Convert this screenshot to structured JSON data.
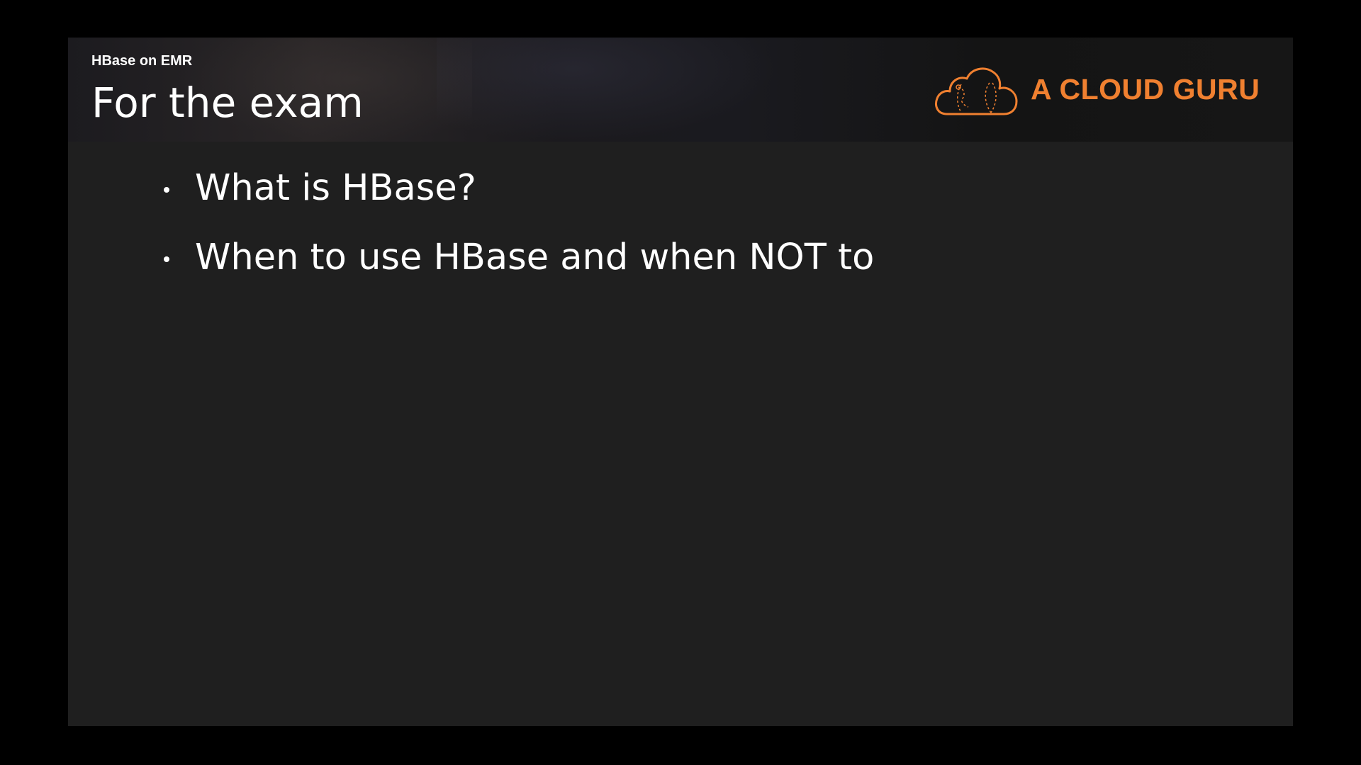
{
  "header": {
    "subtitle": "HBase on EMR",
    "title": "For the exam"
  },
  "logo": {
    "text": "A CLOUD GURU",
    "icon": "cloud-icon",
    "color": "#f08030"
  },
  "bullets": [
    {
      "text": "What is HBase?"
    },
    {
      "text": "When to use HBase and when NOT to"
    }
  ],
  "colors": {
    "background": "#000000",
    "slide": "#1f1f1f",
    "text": "#ffffff",
    "accent": "#f08030"
  }
}
